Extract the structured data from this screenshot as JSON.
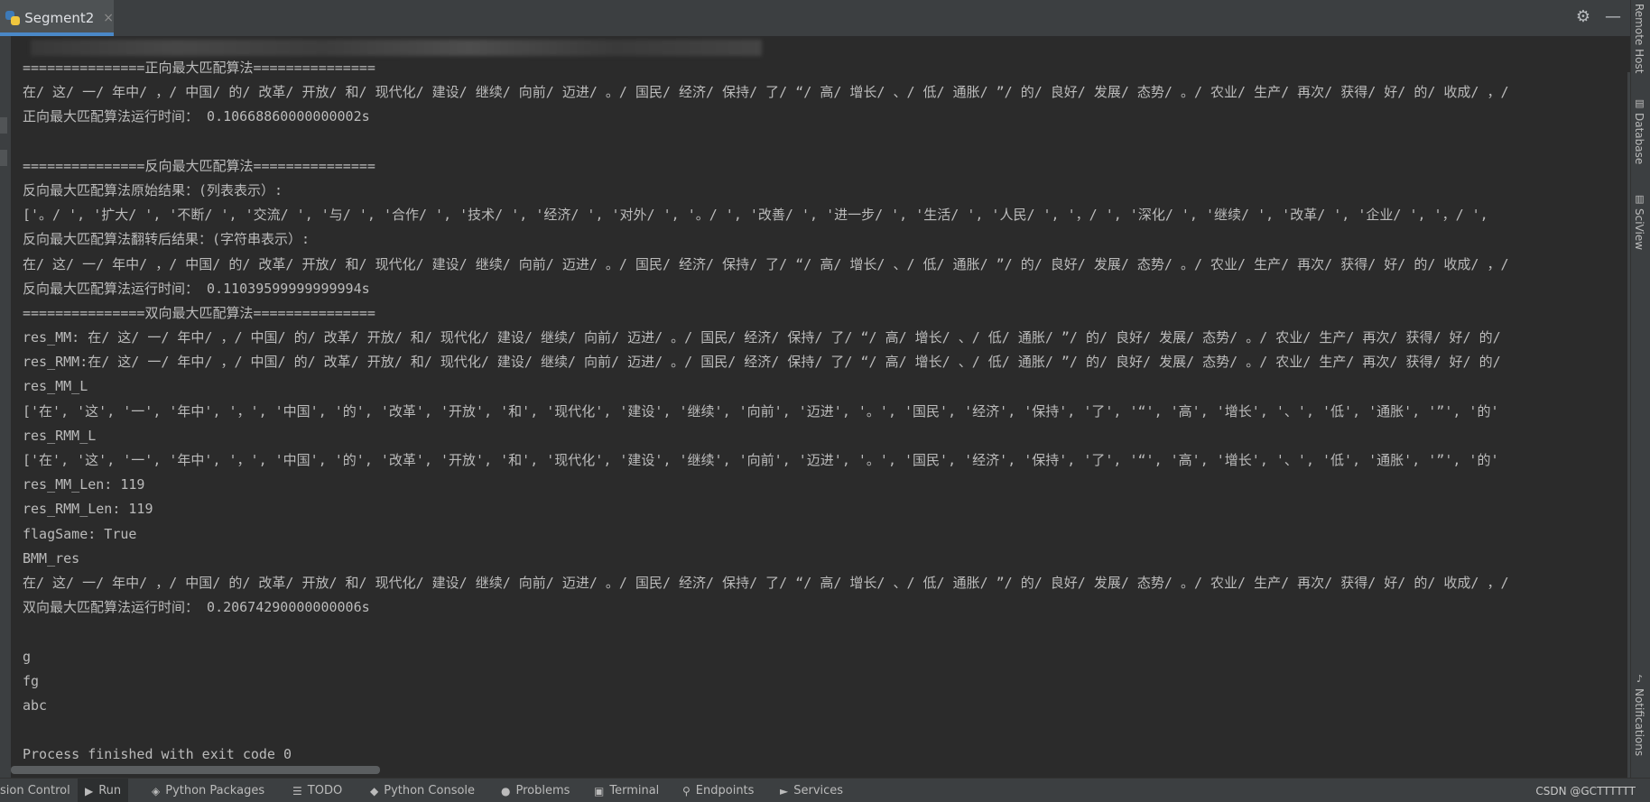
{
  "tab": {
    "title": "Segment2",
    "close": "×"
  },
  "tools": {
    "settings": "⚙",
    "minimize": "—"
  },
  "console": {
    "lines": [
      "===============正向最大匹配算法===============",
      "在/ 这/ 一/ 年中/ ，/ 中国/ 的/ 改革/ 开放/ 和/ 现代化/ 建设/ 继续/ 向前/ 迈进/ 。/ 国民/ 经济/ 保持/ 了/ “/ 高/ 增长/ 、/ 低/ 通胀/ ”/ 的/ 良好/ 发展/ 态势/ 。/ 农业/ 生产/ 再次/ 获得/ 好/ 的/ 收成/ ，/",
      "正向最大匹配算法运行时间： 0.10668860000000002s",
      "",
      "===============反向最大匹配算法===============",
      "反向最大匹配算法原始结果：(列表表示）:",
      "['。/ ', '扩大/ ', '不断/ ', '交流/ ', '与/ ', '合作/ ', '技术/ ', '经济/ ', '对外/ ', '。/ ', '改善/ ', '进一步/ ', '生活/ ', '人民/ ', '，/ ', '深化/ ', '继续/ ', '改革/ ', '企业/ ', '，/ ',",
      "反向最大匹配算法翻转后结果：(字符串表示）:",
      "在/ 这/ 一/ 年中/ ，/ 中国/ 的/ 改革/ 开放/ 和/ 现代化/ 建设/ 继续/ 向前/ 迈进/ 。/ 国民/ 经济/ 保持/ 了/ “/ 高/ 增长/ 、/ 低/ 通胀/ ”/ 的/ 良好/ 发展/ 态势/ 。/ 农业/ 生产/ 再次/ 获得/ 好/ 的/ 收成/ ，/",
      "反向最大匹配算法运行时间： 0.11039599999999994s",
      "===============双向最大匹配算法===============",
      "res_MM: 在/ 这/ 一/ 年中/ ，/ 中国/ 的/ 改革/ 开放/ 和/ 现代化/ 建设/ 继续/ 向前/ 迈进/ 。/ 国民/ 经济/ 保持/ 了/ “/ 高/ 增长/ 、/ 低/ 通胀/ ”/ 的/ 良好/ 发展/ 态势/ 。/ 农业/ 生产/ 再次/ 获得/ 好/ 的/",
      "res_RMM:在/ 这/ 一/ 年中/ ，/ 中国/ 的/ 改革/ 开放/ 和/ 现代化/ 建设/ 继续/ 向前/ 迈进/ 。/ 国民/ 经济/ 保持/ 了/ “/ 高/ 增长/ 、/ 低/ 通胀/ ”/ 的/ 良好/ 发展/ 态势/ 。/ 农业/ 生产/ 再次/ 获得/ 好/ 的/",
      "res_MM_L",
      "['在', '这', '一', '年中', '，', '中国', '的', '改革', '开放', '和', '现代化', '建设', '继续', '向前', '迈进', '。', '国民', '经济', '保持', '了', '“', '高', '增长', '、', '低', '通胀', '”', '的'",
      "res_RMM_L",
      "['在', '这', '一', '年中', '，', '中国', '的', '改革', '开放', '和', '现代化', '建设', '继续', '向前', '迈进', '。', '国民', '经济', '保持', '了', '“', '高', '增长', '、', '低', '通胀', '”', '的'",
      "res_MM_Len: 119",
      "res_RMM_Len: 119",
      "flagSame: True",
      "BMM_res",
      "在/ 这/ 一/ 年中/ ，/ 中国/ 的/ 改革/ 开放/ 和/ 现代化/ 建设/ 继续/ 向前/ 迈进/ 。/ 国民/ 经济/ 保持/ 了/ “/ 高/ 增长/ 、/ 低/ 通胀/ ”/ 的/ 良好/ 发展/ 态势/ 。/ 农业/ 生产/ 再次/ 获得/ 好/ 的/ 收成/ ，/",
      "双向最大匹配算法运行时间： 0.20674290000000006s",
      "",
      "g",
      "fg",
      "abc",
      "",
      "Process finished with exit code 0"
    ]
  },
  "right_strip": {
    "remote_host": "Remote Host",
    "database": "Database",
    "sciview": "SciView",
    "notifications": "Notifications"
  },
  "bottom": {
    "tabs": [
      {
        "label": "sion Control",
        "icon": ""
      },
      {
        "label": "Run",
        "icon": "▶"
      },
      {
        "label": "Python Packages",
        "icon": "◈"
      },
      {
        "label": "TODO",
        "icon": "☰"
      },
      {
        "label": "Python Console",
        "icon": "◆"
      },
      {
        "label": "Problems",
        "icon": "●"
      },
      {
        "label": "Terminal",
        "icon": "▣"
      },
      {
        "label": "Endpoints",
        "icon": "⚲"
      },
      {
        "label": "Services",
        "icon": "►"
      }
    ],
    "watermark": "CSDN @GCTTTTTT"
  }
}
